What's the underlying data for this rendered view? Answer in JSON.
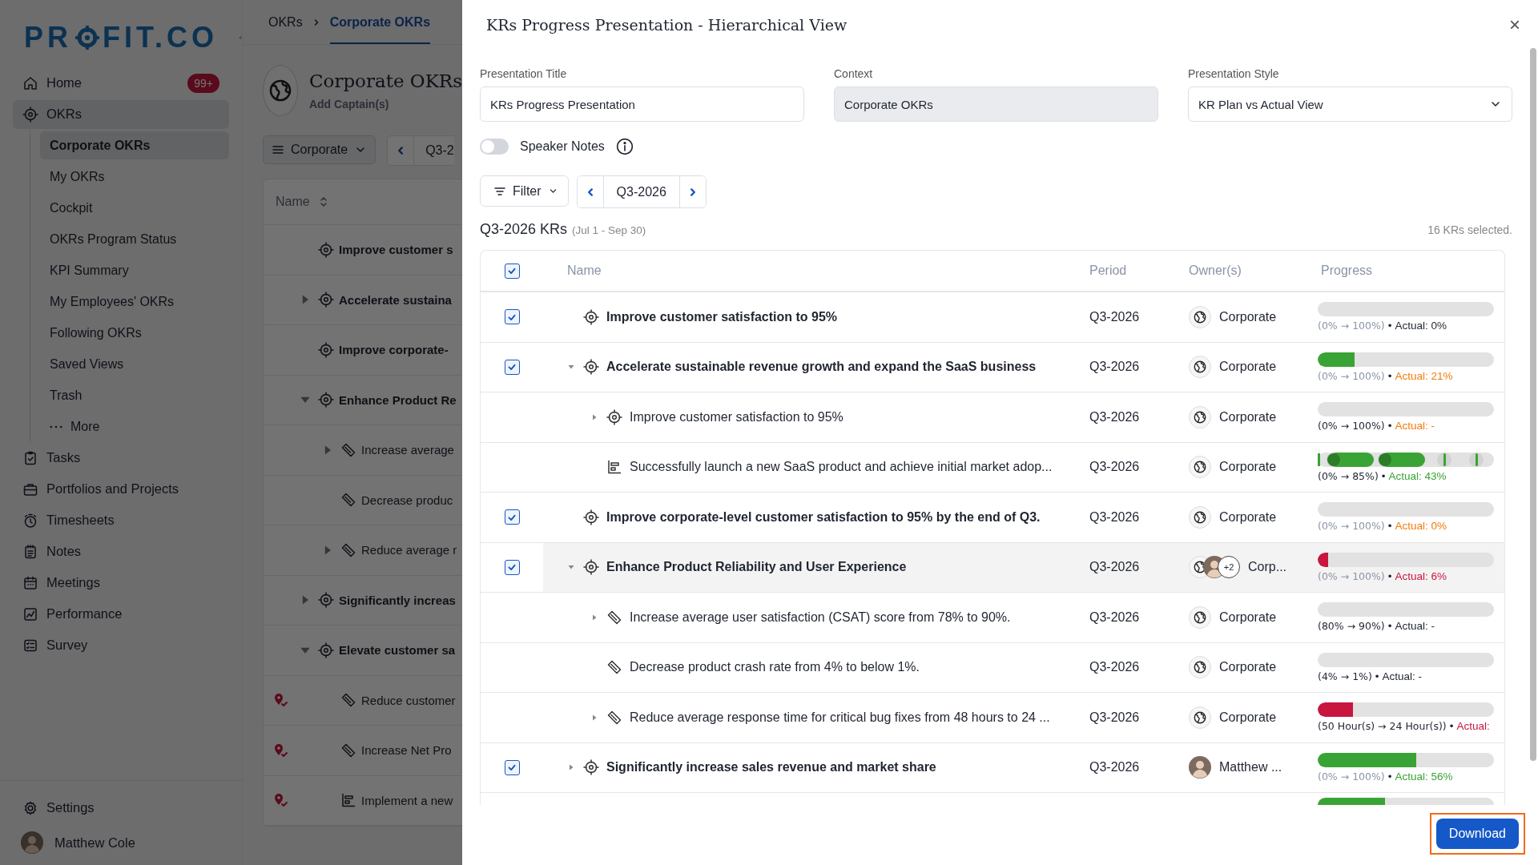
{
  "sidebar": {
    "logo": [
      "PR",
      "FIT.CO"
    ],
    "nav": [
      {
        "label": "Home",
        "badge": "99+",
        "selected": false
      },
      {
        "label": "OKRs",
        "selected": true,
        "children": [
          {
            "label": "Corporate OKRs",
            "selected": true
          },
          {
            "label": "My OKRs",
            "selected": false
          },
          {
            "label": "Cockpit",
            "selected": false
          },
          {
            "label": "OKRs Program Status",
            "selected": false
          },
          {
            "label": "KPI Summary",
            "selected": false
          },
          {
            "label": "My Employees' OKRs",
            "selected": false
          },
          {
            "label": "Following OKRs",
            "selected": false
          },
          {
            "label": "Saved Views",
            "selected": false
          },
          {
            "label": "Trash",
            "selected": false
          },
          {
            "label": "More",
            "kind": "more",
            "selected": false
          }
        ]
      },
      {
        "label": "Tasks",
        "selected": false
      },
      {
        "label": "Portfolios and Projects",
        "selected": false
      },
      {
        "label": "Timesheets",
        "selected": false
      },
      {
        "label": "Notes",
        "selected": false
      },
      {
        "label": "Meetings",
        "selected": false
      },
      {
        "label": "Performance",
        "selected": false
      },
      {
        "label": "Survey",
        "selected": false
      }
    ],
    "settings": "Settings",
    "user": "Matthew Cole"
  },
  "page": {
    "breadcrumb": [
      {
        "label": "OKRs",
        "selected": false
      },
      {
        "label": "Corporate OKRs",
        "selected": true
      }
    ],
    "title": "Corporate OKRs",
    "subtitle": "Add Captain(s)",
    "view_button": "Corporate",
    "period": "Q3-2",
    "column": "Name",
    "rows": [
      {
        "name": "Improve customer s",
        "kind": "objective",
        "flagged": false
      },
      {
        "name": "Accelerate sustaina",
        "kind": "objective",
        "expanded": false,
        "flagged": false
      },
      {
        "name": "Improve corporate-",
        "kind": "objective",
        "flagged": false
      },
      {
        "name": "Enhance Product Re",
        "kind": "objective",
        "expanded": true,
        "flagged": false,
        "children": [
          {
            "name": "Increase average",
            "kind": "kr",
            "expanded": false,
            "flagged": false
          },
          {
            "name": "Decrease produc",
            "kind": "kr",
            "flagged": false
          },
          {
            "name": "Reduce average r",
            "kind": "kr",
            "expanded": false,
            "flagged": false
          }
        ]
      },
      {
        "name": "Significantly increas",
        "kind": "objective",
        "expanded": false,
        "flagged": false
      },
      {
        "name": "Elevate customer sa",
        "kind": "objective",
        "expanded": true,
        "flagged": false,
        "children": [
          {
            "name": "Reduce customer",
            "kind": "kr",
            "flagged": true
          },
          {
            "name": "Increase Net Pro",
            "kind": "kr",
            "flagged": true
          },
          {
            "name": "Implement a new",
            "kind": "initiative",
            "flagged": true
          }
        ]
      }
    ]
  },
  "dialog": {
    "title": "KRs Progress Presentation - Hierarchical View",
    "close": "×",
    "fields": [
      {
        "label": "Presentation Title",
        "value": "KRs Progress Presentation",
        "kind": "input"
      },
      {
        "label": "Context",
        "value": "Corporate OKRs",
        "kind": "readonly"
      },
      {
        "label": "Presentation Style",
        "value": "KR Plan vs Actual View",
        "kind": "select"
      }
    ],
    "speaker_notes": {
      "label": "Speaker Notes",
      "on": false
    },
    "filter": "Filter",
    "period": "Q3-2026",
    "heading": "Q3-2026 KRs",
    "date_range": "(Jul 1 - Sep 30)",
    "selected_count": "16 KRs selected.",
    "columns": [
      "Name",
      "Period",
      "Owner(s)",
      "Progress"
    ],
    "all_checked": true,
    "rows": [
      {
        "name": "Improve customer satisfaction to 95%",
        "kind": "objective",
        "checked": true,
        "highlighted": false,
        "period": "Q3-2026",
        "owner": {
          "avatars": [
            {
              "kind": "group"
            }
          ],
          "name": "Corporate"
        },
        "progress": {
          "kind": "bar",
          "level": 0,
          "range": "(0% → 100%)",
          "muted": true,
          "separator": "•",
          "actual": {
            "text": "Actual: 0%",
            "color": "#1f2430"
          }
        }
      },
      {
        "name": "Accelerate sustainable revenue growth and expand the SaaS business",
        "kind": "objective",
        "checked": true,
        "highlighted": false,
        "expanded": true,
        "period": "Q3-2026",
        "owner": {
          "avatars": [
            {
              "kind": "group"
            }
          ],
          "name": "Corporate"
        },
        "progress": {
          "kind": "bar",
          "level": 0.21,
          "color": "#3aa335",
          "range": "(0% → 100%)",
          "muted": true,
          "separator": "•",
          "actual": {
            "text": "Actual: 21%",
            "color": "#f07c0d"
          }
        },
        "children": [
          {
            "name": "Improve customer satisfaction to 95%",
            "kind": "objective",
            "expanded": false,
            "period": "Q3-2026",
            "owner": {
              "avatars": [
                {
                  "kind": "group"
                }
              ],
              "name": "Corporate"
            },
            "progress": {
              "kind": "bar",
              "level": 0,
              "range": "(0% → 100%)",
              "muted": false,
              "separator": "•",
              "actual": {
                "text": "Actual: -",
                "color": "#f07c0d"
              }
            }
          },
          {
            "name": "Successfully launch a new SaaS product and achieve initial market adop...",
            "kind": "initiative",
            "period": "Q3-2026",
            "owner": {
              "avatars": [
                {
                  "kind": "group"
                }
              ],
              "name": "Corporate"
            },
            "progress": {
              "kind": "segmented",
              "range": "(0% → 85%)",
              "muted": false,
              "separator": "•",
              "actual": {
                "text": "Actual: 43%",
                "color": "#3aa335"
              }
            }
          }
        ]
      },
      {
        "name": "Improve corporate-level customer satisfaction to 95% by the end of Q3.",
        "kind": "objective",
        "checked": true,
        "highlighted": false,
        "period": "Q3-2026",
        "owner": {
          "avatars": [
            {
              "kind": "group"
            }
          ],
          "name": "Corporate"
        },
        "progress": {
          "kind": "bar",
          "level": 0,
          "range": "(0% → 100%)",
          "muted": true,
          "separator": "•",
          "actual": {
            "text": "Actual: 0%",
            "color": "#f07c0d"
          }
        }
      },
      {
        "name": "Enhance Product Reliability and User Experience",
        "kind": "objective",
        "checked": true,
        "highlighted": true,
        "expanded": true,
        "period": "Q3-2026",
        "owner": {
          "avatars": [
            {
              "kind": "group"
            },
            {
              "kind": "person"
            }
          ],
          "more": "+2",
          "name": "Corp..."
        },
        "progress": {
          "kind": "bar",
          "level": 0.06,
          "color": "#c8163f",
          "range": "(0% → 100%)",
          "muted": true,
          "separator": "•",
          "actual": {
            "text": "Actual: 6%",
            "color": "#c8163f"
          }
        },
        "children": [
          {
            "name": "Increase average user satisfaction (CSAT) score from 78% to 90%.",
            "kind": "kr",
            "expanded": false,
            "period": "Q3-2026",
            "owner": {
              "avatars": [
                {
                  "kind": "group"
                }
              ],
              "name": "Corporate"
            },
            "progress": {
              "kind": "bar",
              "level": 0,
              "range": "(80% → 90%)",
              "muted": false,
              "separator": "•",
              "actual": {
                "text": "Actual: -",
                "color": "#1f2430"
              }
            }
          },
          {
            "name": "Decrease product crash rate from 4% to below 1%.",
            "kind": "kr",
            "period": "Q3-2026",
            "owner": {
              "avatars": [
                {
                  "kind": "group"
                }
              ],
              "name": "Corporate"
            },
            "progress": {
              "kind": "bar",
              "level": 0,
              "range": "(4% → 1%)",
              "muted": false,
              "separator": "•",
              "actual": {
                "text": "Actual: -",
                "color": "#1f2430"
              }
            }
          },
          {
            "name": "Reduce average response time for critical bug fixes from 48 hours to 24 ...",
            "kind": "kr",
            "expanded": false,
            "period": "Q3-2026",
            "owner": {
              "avatars": [
                {
                  "kind": "group"
                }
              ],
              "name": "Corporate"
            },
            "progress": {
              "kind": "bar",
              "level": 0.2,
              "color": "#c8163f",
              "range": "(50 Hour(s) → 24 Hour(s))",
              "muted": false,
              "separator": "•",
              "actual": {
                "text": "Actual:",
                "color": "#c8163f"
              }
            }
          }
        ]
      },
      {
        "name": "Significantly increase sales revenue and market share",
        "kind": "objective",
        "checked": true,
        "highlighted": false,
        "expanded": false,
        "period": "Q3-2026",
        "owner": {
          "avatars": [
            {
              "kind": "person"
            }
          ],
          "name": "Matthew ..."
        },
        "progress": {
          "kind": "bar",
          "level": 0.56,
          "color": "#3aa335",
          "range": "(0% → 100%)",
          "muted": true,
          "separator": "•",
          "actual": {
            "text": "Actual: 56%",
            "color": "#3aa335"
          }
        }
      }
    ],
    "partial_row": {
      "level": 0.38,
      "color": "#3aa335"
    },
    "download": "Download"
  }
}
